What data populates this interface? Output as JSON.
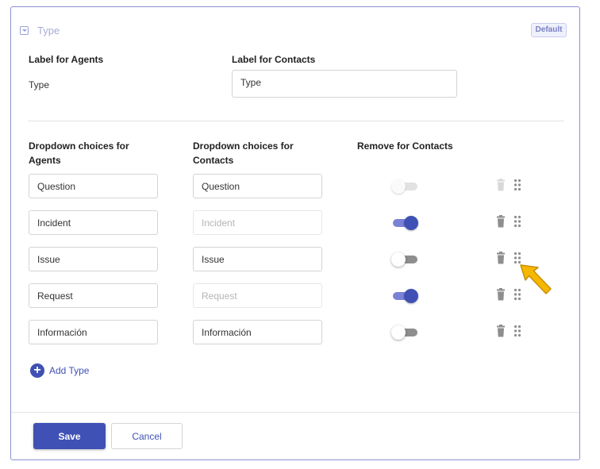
{
  "header": {
    "title": "Type",
    "badge": "Default"
  },
  "labels": {
    "agents_label": "Label for Agents",
    "contacts_label": "Label for Contacts",
    "agents_value": "Type",
    "contacts_value": "Type"
  },
  "columns": {
    "agents": "Dropdown choices for Agents",
    "contacts": "Dropdown choices for Contacts",
    "remove": "Remove for Contacts"
  },
  "rows": [
    {
      "agent": "Question",
      "contact": "Question",
      "removed": false,
      "toggle_disabled": true
    },
    {
      "agent": "Incident",
      "contact": "Incident",
      "removed": true,
      "toggle_disabled": false
    },
    {
      "agent": "Issue",
      "contact": "Issue",
      "removed": false,
      "toggle_disabled": false
    },
    {
      "agent": "Request",
      "contact": "Request",
      "removed": true,
      "toggle_disabled": false
    },
    {
      "agent": "Información",
      "contact": "Información",
      "removed": false,
      "toggle_disabled": false
    }
  ],
  "add_label": "Add Type",
  "footer": {
    "save": "Save",
    "cancel": "Cancel"
  },
  "colors": {
    "accent": "#3f51b5",
    "cursor": "#f5b800"
  },
  "icons": [
    "dropdown-square-icon",
    "trash-icon",
    "drag-handle-icon",
    "plus-icon",
    "cursor-arrow-icon"
  ]
}
